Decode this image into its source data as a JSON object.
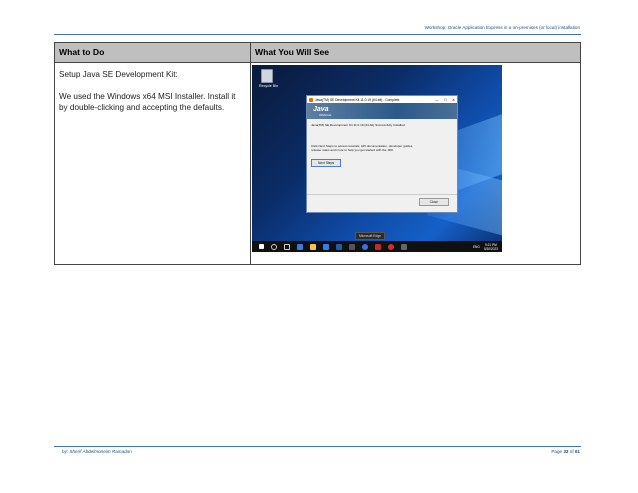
{
  "header": {
    "text": "Workshop: Oracle Application Express in a on-premises (or local) installation"
  },
  "table": {
    "col1_header": "What to Do",
    "col2_header": "What You Will See",
    "instruction_title": "Setup Java SE Development Kit:",
    "instruction_body": "We used the Windows x64 MSI Installer. Install it by double-clicking and accepting the defaults."
  },
  "screenshot": {
    "recycle_bin_label": "Recycle Bin",
    "dialog_title": "Java(TM) SE Development Kit 11.0.19 (64-bit) - Complete",
    "logo_text": "Java",
    "logo_subtext": "ORACLE",
    "success_message": "Java(TM) SE Development Kit 11.0.19 (64-bit) Successfully Installed",
    "next_steps_message": "Click Next Steps to access tutorials, API documentation, developer guides, release notes and more to help you get started with the JDK.",
    "next_steps_button": "Next Steps",
    "close_button": "Close",
    "minimize": "—",
    "maximize": "☐",
    "close_x": "✕",
    "taskbar_tooltip": "Microsoft Edge",
    "tray_lang": "ENG",
    "clock_time": "9:21 PM",
    "clock_date": "5/30/2023",
    "colors": {
      "taskbar": "#101010",
      "desktop": "#0b2c66",
      "accent": "#4472c4"
    }
  },
  "footer": {
    "author": "by: Sherif Abdelmoneim Ramadan",
    "page_prefix": "Page ",
    "page_number": "33",
    "page_sep": " of ",
    "page_total": "61"
  }
}
